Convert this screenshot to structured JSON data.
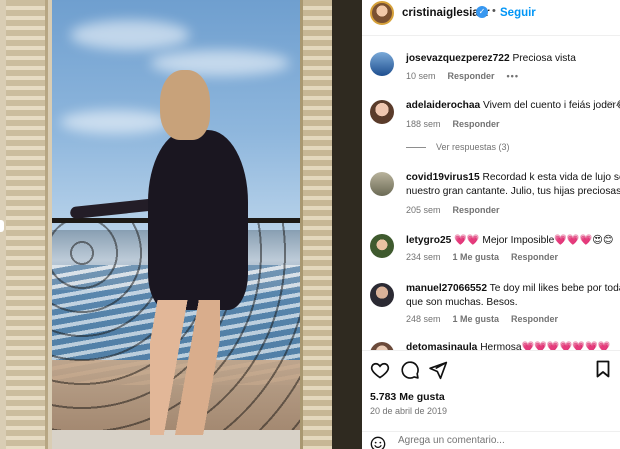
{
  "post": {
    "author": "cristinaiglesiasr",
    "follow_label": "Seguir",
    "separator": "•",
    "verified_icon": "✓"
  },
  "comments": [
    {
      "username": "josevazquezperez722",
      "text": "Preciosa vista",
      "time": "10 sem",
      "reply_label": "Responder",
      "more": "•••"
    },
    {
      "username": "adelaiderochaa",
      "text": "Vivem del cuento i feiás joder😂",
      "time": "188 sem",
      "reply_label": "Responder"
    },
    {
      "username": "covid19virus15",
      "text": "Recordad k esta vida de lujo se lo",
      "text_line2": "nuestro gran cantante. Julio, tus hijas preciosas!!",
      "time": "205 sem",
      "reply_label": "Responder"
    },
    {
      "username": "letygro25",
      "text": "💗💗 Mejor Imposible💗💗💗😍😊",
      "time": "234 sem",
      "likes": "1 Me gusta",
      "reply_label": "Responder"
    },
    {
      "username": "manuel27066552",
      "text": "Te doy mil likes bebe por toda",
      "text_line2": "que son muchas. Besos.",
      "time": "248 sem",
      "likes": "1 Me gusta",
      "reply_label": "Responder"
    },
    {
      "username": "detomasinaula",
      "text": "Hermosa💗💗💗💗💗💗💗"
    }
  ],
  "view_replies_label": "Ver respuestas (3)",
  "actions": {
    "likes": "5.783 Me gusta",
    "date": "20 de abril de 2019"
  },
  "add_comment": {
    "placeholder": "Agrega un comentario..."
  },
  "colors": {
    "accent": "#0095f6",
    "verified": "#3797f0",
    "muted": "#737373"
  },
  "icons": [
    "heart-icon",
    "comment-icon",
    "share-icon",
    "bookmark-icon",
    "emoji-icon",
    "verified-icon"
  ]
}
